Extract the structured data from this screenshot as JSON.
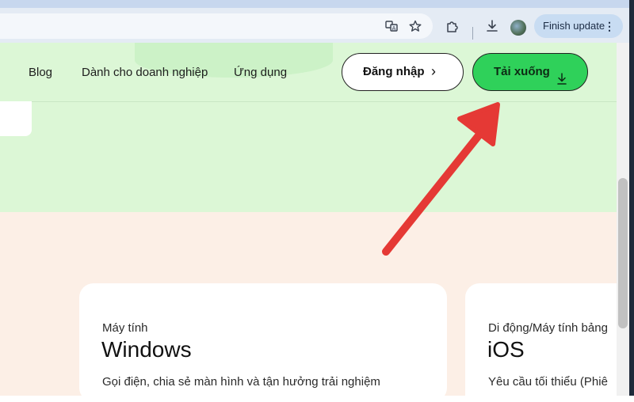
{
  "browser": {
    "finish_update_label": "Finish update",
    "menu_glyph": "⋮",
    "icons": [
      "translate-icon",
      "star-icon",
      "extensions-icon",
      "download-icon",
      "profile-avatar",
      "kebab-menu-icon"
    ]
  },
  "nav": {
    "links": [
      "Blog",
      "Dành cho doanh nghiệp",
      "Ứng dụng"
    ],
    "login_label": "Đăng nhập",
    "download_label": "Tải xuống"
  },
  "cards": [
    {
      "label": "Máy tính",
      "title": "Windows",
      "description": "Gọi điện, chia sẻ màn hình và tận hưởng trải nghiệm"
    },
    {
      "label": "Di động/Máy tính bảng",
      "title": "iOS",
      "description": "Yêu cầu tối thiểu (Phiê"
    }
  ],
  "colors": {
    "download_button": "#2fd15a",
    "hero_background": "#dcf7d6",
    "content_background": "#fcefe6",
    "annotation_arrow": "#e53935"
  }
}
